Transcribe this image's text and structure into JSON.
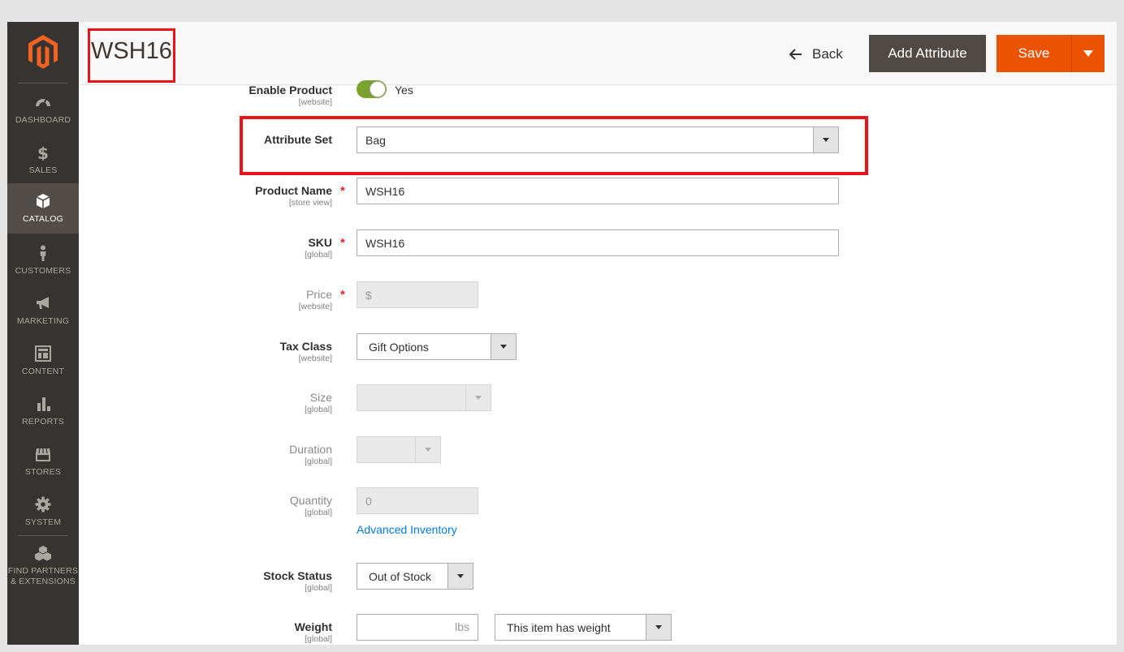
{
  "sidebar": {
    "items": [
      {
        "label": "DASHBOARD",
        "icon": "dashboard-icon"
      },
      {
        "label": "SALES",
        "icon": "dollar-icon"
      },
      {
        "label": "CATALOG",
        "icon": "box-icon",
        "active": true
      },
      {
        "label": "CUSTOMERS",
        "icon": "person-icon"
      },
      {
        "label": "MARKETING",
        "icon": "megaphone-icon"
      },
      {
        "label": "CONTENT",
        "icon": "layout-icon"
      },
      {
        "label": "REPORTS",
        "icon": "bar-chart-icon"
      },
      {
        "label": "STORES",
        "icon": "storefront-icon"
      },
      {
        "label": "SYSTEM",
        "icon": "gear-icon"
      },
      {
        "label": "FIND PARTNERS\n& EXTENSIONS",
        "label_line1": "FIND PARTNERS",
        "label_line2": "& EXTENSIONS",
        "icon": "cubes-icon"
      }
    ]
  },
  "header": {
    "title": "WSH16",
    "back_label": "Back",
    "add_attribute_label": "Add Attribute",
    "save_label": "Save"
  },
  "form": {
    "enable_product": {
      "label": "Enable Product",
      "scope": "[website]",
      "value": "Yes"
    },
    "attribute_set": {
      "label": "Attribute Set",
      "value": "Bag"
    },
    "product_name": {
      "label": "Product Name",
      "scope": "[store view]",
      "value": "WSH16",
      "required": "*"
    },
    "sku": {
      "label": "SKU",
      "scope": "[global]",
      "value": "WSH16",
      "required": "*"
    },
    "price": {
      "label": "Price",
      "scope": "[website]",
      "prefix": "$",
      "required": "*"
    },
    "tax_class": {
      "label": "Tax Class",
      "scope": "[website]",
      "value": "Gift Options"
    },
    "size": {
      "label": "Size",
      "scope": "[global]"
    },
    "duration": {
      "label": "Duration",
      "scope": "[global]"
    },
    "quantity": {
      "label": "Quantity",
      "scope": "[global]",
      "value": "0",
      "advanced_link": "Advanced Inventory"
    },
    "stock_status": {
      "label": "Stock Status",
      "scope": "[global]",
      "value": "Out of Stock"
    },
    "weight": {
      "label": "Weight",
      "scope": "[global]",
      "unit": "lbs",
      "weight_type": "This item has weight"
    }
  },
  "colors": {
    "sidebar_bg": "#373330",
    "accent_orange": "#eb5202",
    "highlight_red": "#e8141a",
    "toggle_green": "#79a22e",
    "link_blue": "#007bdb"
  }
}
